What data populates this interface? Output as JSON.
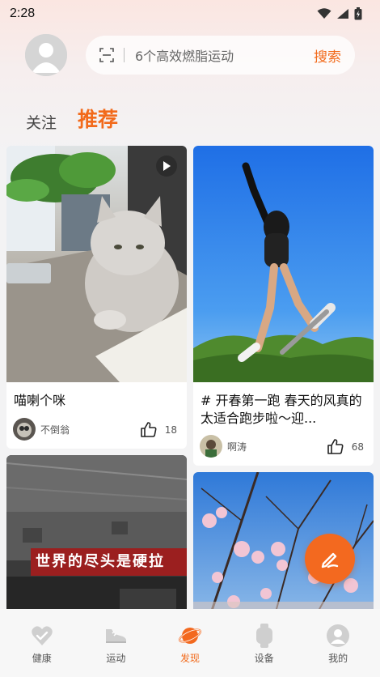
{
  "status_bar": {
    "time": "2:28"
  },
  "search": {
    "placeholder": "6个高效燃脂运动",
    "button_label": "搜索"
  },
  "tabs": [
    {
      "label": "关注",
      "active": false
    },
    {
      "label": "推荐",
      "active": true
    }
  ],
  "feed": {
    "left": [
      {
        "title": "喵喇个咪",
        "author": "不倒翁",
        "likes": "18",
        "is_video": true
      },
      {
        "banner_text": "世界的尽头是硬拉"
      }
    ],
    "right": [
      {
        "title": "# 开春第一跑 春天的风真的太适合跑步啦～迎...",
        "author": "啊涛",
        "likes": "68"
      }
    ]
  },
  "bottom_nav": [
    {
      "label": "健康",
      "icon": "heart-icon",
      "active": false
    },
    {
      "label": "运动",
      "icon": "shoe-icon",
      "active": false
    },
    {
      "label": "发现",
      "icon": "planet-icon",
      "active": true
    },
    {
      "label": "设备",
      "icon": "watch-icon",
      "active": false
    },
    {
      "label": "我的",
      "icon": "person-icon",
      "active": false
    }
  ],
  "colors": {
    "accent": "#f26a1b",
    "fab": "#f3691f"
  }
}
